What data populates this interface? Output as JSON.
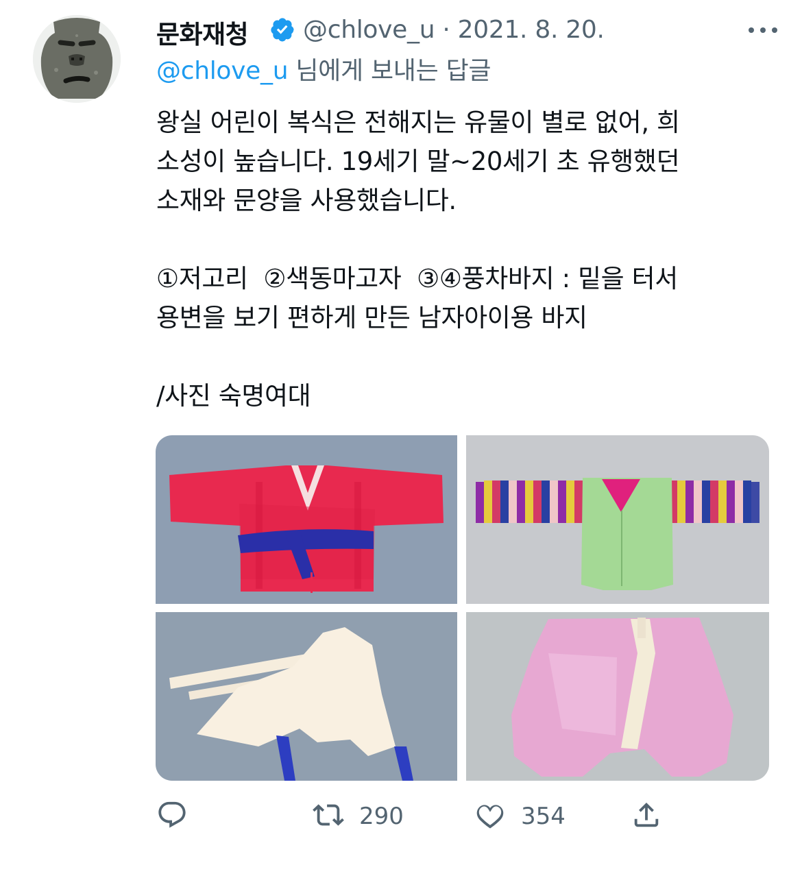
{
  "tweet": {
    "display_name": "문화재청",
    "handle_date": "@chlove_u · 2021. 8. 20.",
    "reply_to_handle": "@chlove_u",
    "reply_suffix": " 님에게 보내는 답글",
    "body": {
      "line1": "왕실 어린이 복식은 전해지는 유물이 별로 없어, 희",
      "line2": "소성이 높습니다. 19세기 말~20세기 초 유행했던",
      "line3": "소재와 문양을 사용했습니다.",
      "line4": "①저고리  ②색동마고자  ③④풍차바지 : 밑을 터서",
      "line5": "용변을 보기 편하게 만든 남자아이용 바지",
      "line6": "/사진 숙명여대"
    },
    "counts": {
      "retweets": "290",
      "likes": "354"
    }
  },
  "icons": {
    "verified": "verified-badge-icon",
    "more": "more-options-icon",
    "reply": "reply-icon",
    "retweet": "retweet-icon",
    "like": "heart-icon",
    "share": "share-icon"
  },
  "colors": {
    "accent": "#1d9bf0",
    "secondary_text": "#536471",
    "primary_text": "#0f1419"
  }
}
